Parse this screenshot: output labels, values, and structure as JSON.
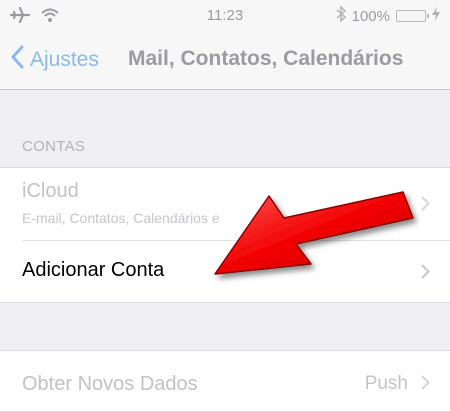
{
  "status_bar": {
    "airplane_icon": "airplane-icon",
    "wifi_icon": "wifi-icon",
    "time": "11:23",
    "bluetooth_icon": "bluetooth-icon",
    "battery_percent": "100%",
    "battery_level": 1.0,
    "charging_icon": "charging-bolt-icon"
  },
  "nav": {
    "back_label": "Ajustes",
    "title": "Mail, Contatos, Calendários"
  },
  "sections": {
    "accounts_header": "CONTAS"
  },
  "accounts": [
    {
      "title": "iCloud",
      "subtitle": "E-mail, Contatos, Calendários e"
    },
    {
      "title": "Adicionar Conta"
    }
  ],
  "fetch": {
    "title": "Obter Novos Dados",
    "value": "Push"
  },
  "colors": {
    "accent": "#8ab9ee",
    "arrow": "#e00000",
    "battery": "#4cd964"
  }
}
